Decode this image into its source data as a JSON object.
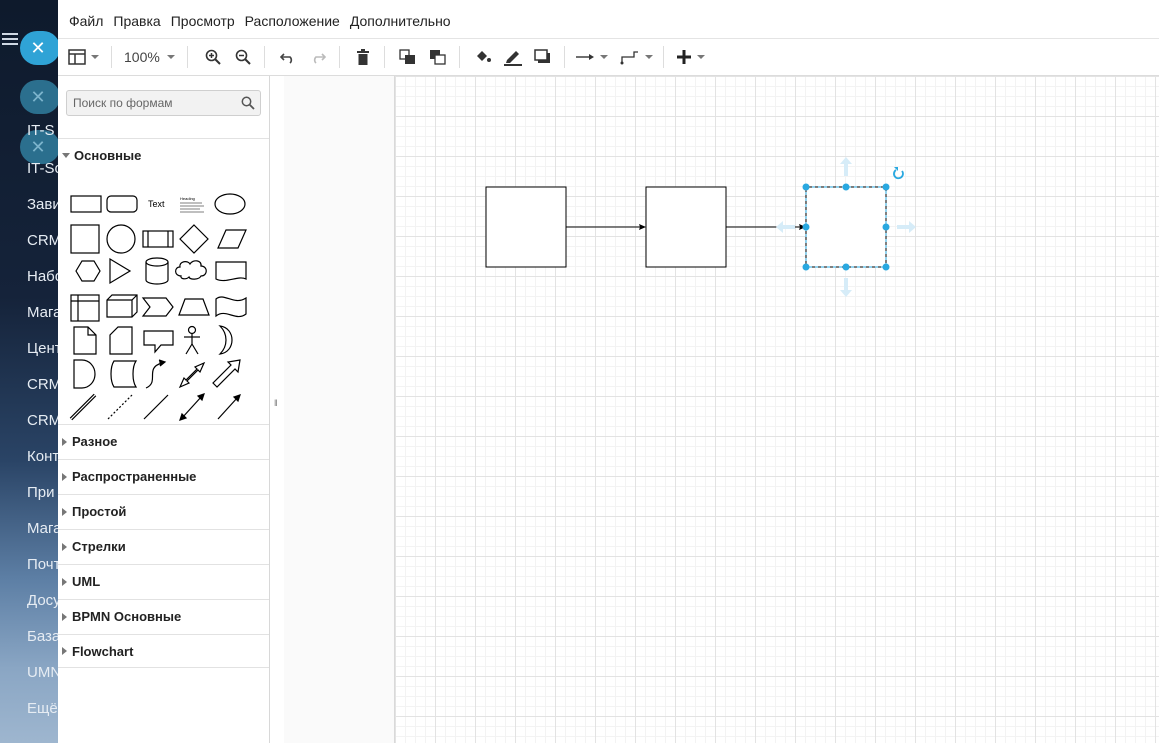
{
  "background_app": {
    "items": [
      "IT-S",
      "IT-So",
      "Зави",
      "CRM",
      "Набо",
      "Мага",
      "Цент",
      "CRM",
      "CRM",
      "Конт",
      "При",
      "Мага",
      "Почт",
      "Досу",
      "База",
      "UMN",
      "Ещё"
    ]
  },
  "menu": {
    "file": "Файл",
    "edit": "Правка",
    "view": "Просмотр",
    "arrange": "Расположение",
    "extras": "Дополнительно"
  },
  "toolbar": {
    "zoom": "100%"
  },
  "search": {
    "placeholder": "Поиск по формам"
  },
  "sections": {
    "general": "Основные",
    "misc": "Разное",
    "advanced": "Распространенные",
    "basic": "Простой",
    "arrows": "Стрелки",
    "uml": "UML",
    "bpmn": "BPMN Основные",
    "flowchart": "Flowchart"
  },
  "shapes": {
    "text_label": "Text",
    "heading_label": "Heading"
  },
  "colors": {
    "accent": "#29a8e0",
    "selection": "#29a8e0",
    "grid_major": "#e3e3e3",
    "grid_minor": "#f3f3f3"
  }
}
